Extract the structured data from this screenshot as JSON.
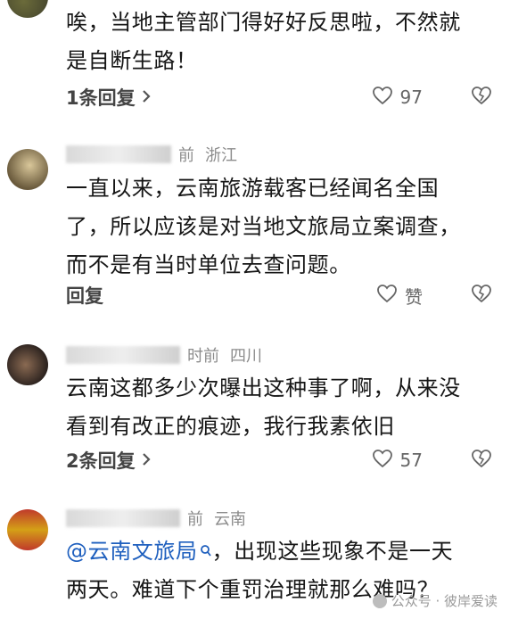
{
  "comments": [
    {
      "lines": [
        "唉，当地主管部门得好好反思啦，不然就",
        "是自断生路！"
      ],
      "reply_label": "1条回复",
      "likes": "97"
    },
    {
      "time": "前",
      "region": "浙江",
      "lines": [
        "一直以来，云南旅游载客已经闻名全国",
        "了，所以应该是对当地文旅局立案调查，",
        "而不是有当时单位去查问题。"
      ],
      "reply_label": "回复",
      "likes": "赞"
    },
    {
      "time": "时前",
      "region": "四川",
      "lines": [
        "云南这都多少次曝出这种事了啊，从来没",
        "看到有改正的痕迹，我行我素依旧"
      ],
      "reply_label": "2条回复",
      "likes": "57"
    },
    {
      "time": "前",
      "region": "云南",
      "mention": "@云南文旅局",
      "line1_rest": "，出现这些现象不是一天",
      "line2": "两天。难道下个重罚治理就那么难吗？"
    }
  ],
  "watermark": "公众号 · 彼岸爱读",
  "colors": {
    "mention": "#1e5fbe",
    "meta": "#8c8c8c",
    "text": "#161616"
  },
  "icons": {
    "reply_more": "chevron-right-icon",
    "like": "heart-outline-icon",
    "dislike": "broken-heart-icon",
    "search": "search-icon"
  }
}
